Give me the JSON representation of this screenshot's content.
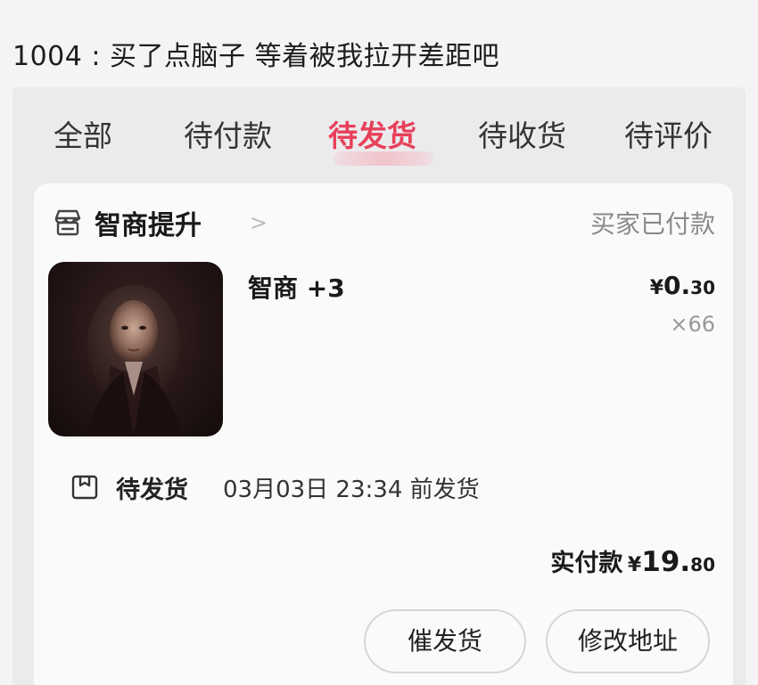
{
  "caption": "1004 : 买了点脑子 等着被我拉开差距吧",
  "tabs": [
    {
      "label": "全部",
      "active": false
    },
    {
      "label": "待付款",
      "active": false
    },
    {
      "label": "待发货",
      "active": true
    },
    {
      "label": "待收货",
      "active": false
    },
    {
      "label": "待评价",
      "active": false
    }
  ],
  "order": {
    "shop_icon": "store-icon",
    "shop_name": "智商提升",
    "shop_chevron": ">",
    "status": "买家已付款",
    "product": {
      "image_icon": "portrait-image",
      "name": "智商 +3",
      "price_currency": "¥",
      "price_int": "0.",
      "price_dec": "30",
      "quantity": "×66"
    },
    "shipping": {
      "icon": "package-box-icon",
      "label": "待发货",
      "detail": "03月03日 23:34 前发货"
    },
    "paid": {
      "label": "实付款",
      "currency": "¥",
      "int": "19.",
      "dec": "80"
    },
    "buttons": {
      "urge": "催发货",
      "change_address": "修改地址"
    }
  },
  "colors": {
    "accent": "#e8405a",
    "page_bg": "#f4f4f6",
    "card_bg": "#fafafa"
  }
}
